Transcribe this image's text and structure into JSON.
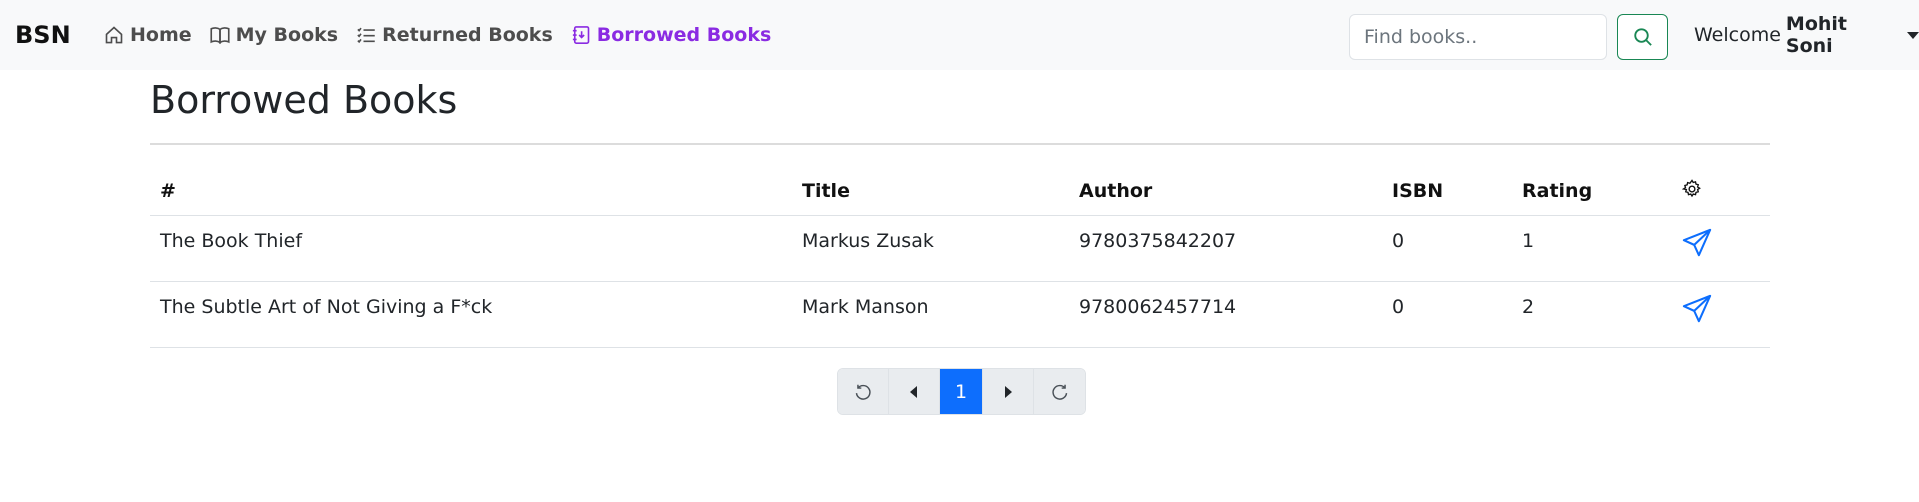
{
  "navbar": {
    "brand": "BSN",
    "links": [
      {
        "label": "Home",
        "icon": "home-icon"
      },
      {
        "label": "My Books",
        "icon": "book-open-icon"
      },
      {
        "label": "Returned Books",
        "icon": "list-check-icon"
      },
      {
        "label": "Borrowed Books",
        "icon": "journal-arrow-down-icon",
        "active": true
      }
    ],
    "search": {
      "placeholder": "Find books..",
      "value": ""
    },
    "welcome": {
      "prefix": "Welcome",
      "user": "Mohit Soni"
    }
  },
  "page": {
    "title": "Borrowed Books"
  },
  "table": {
    "headers": [
      "#",
      "Title",
      "Author",
      "ISBN",
      "Rating"
    ],
    "rows": [
      {
        "c1": "The Book Thief",
        "c2": "Markus Zusak",
        "c3": "9780375842207",
        "c4": "0",
        "c5": "1"
      },
      {
        "c1": "The Subtle Art of Not Giving a F*ck",
        "c2": "Mark Manson",
        "c3": "9780062457714",
        "c4": "0",
        "c5": "2"
      }
    ]
  },
  "pagination": {
    "current": "1"
  },
  "colors": {
    "accent": "#8a2be2",
    "primary": "#0d6efd",
    "success": "#198754"
  }
}
